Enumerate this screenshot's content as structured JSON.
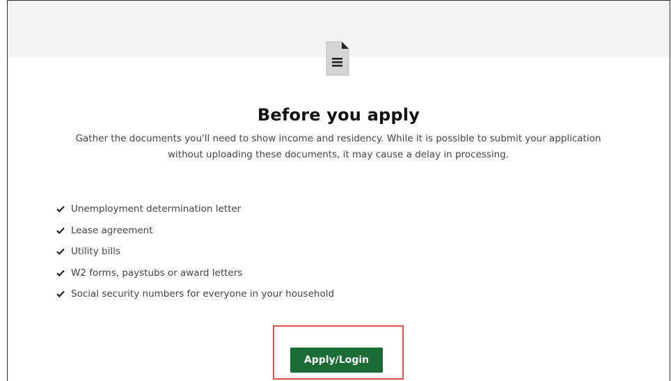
{
  "icon": "document-icon",
  "section": {
    "title": "Before you apply",
    "description": "Gather the documents you'll need to show income and residency. While it is possible to submit your application without uploading these documents, it may cause a delay in processing."
  },
  "requirements": [
    {
      "label": "Unemployment determination letter"
    },
    {
      "label": "Lease agreement"
    },
    {
      "label": "Utility bills"
    },
    {
      "label": "W2 forms, paystubs or award letters"
    },
    {
      "label": "Social security numbers for everyone in your household"
    }
  ],
  "actions": {
    "apply_label": "Apply/Login"
  },
  "colors": {
    "button": "#1b6b35",
    "highlight": "#d9534f",
    "band": "#f2f3f2"
  }
}
